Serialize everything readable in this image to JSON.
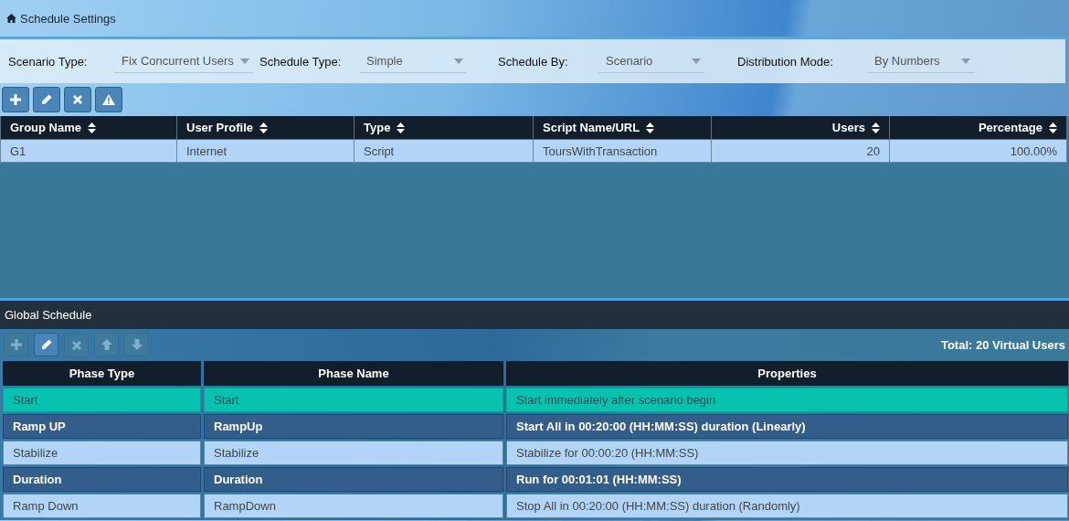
{
  "header": {
    "title": "Schedule Settings"
  },
  "filters": [
    {
      "label": "Scenario Type:",
      "value": "Fix Concurrent Users"
    },
    {
      "label": "Schedule Type:",
      "value": "Simple"
    },
    {
      "label": "Schedule By:",
      "value": "Scenario"
    },
    {
      "label": "Distribution Mode:",
      "value": "By Numbers"
    }
  ],
  "group_toolbar": [
    {
      "kind": "add",
      "disabled": false
    },
    {
      "kind": "edit",
      "disabled": false
    },
    {
      "kind": "delete",
      "disabled": false
    },
    {
      "kind": "warning",
      "disabled": false
    }
  ],
  "groups_table": {
    "columns": [
      {
        "label": "Group Name",
        "kind": "text"
      },
      {
        "label": "User Profile",
        "kind": "text"
      },
      {
        "label": "Type",
        "kind": "text"
      },
      {
        "label": "Script Name/URL",
        "kind": "text"
      },
      {
        "label": "Users",
        "kind": "number"
      },
      {
        "label": "Percentage",
        "kind": "number"
      }
    ],
    "rows": [
      {
        "cells": [
          "G1",
          "Internet",
          "Script",
          "ToursWithTransaction",
          "20",
          "100.00%"
        ]
      }
    ]
  },
  "global_schedule": {
    "title": "Global Schedule",
    "toolbar": [
      {
        "kind": "add",
        "disabled": true
      },
      {
        "kind": "edit",
        "disabled": false
      },
      {
        "kind": "delete",
        "disabled": true
      },
      {
        "kind": "up",
        "disabled": true
      },
      {
        "kind": "down",
        "disabled": true
      }
    ],
    "total": "Total: 20 Virtual Users",
    "columns": [
      "Phase Type",
      "Phase Name",
      "Properties"
    ],
    "rows": [
      {
        "cells": [
          "Start",
          "Start",
          "Start immediately after scenario begin"
        ],
        "selected": true
      },
      {
        "cells": [
          "Ramp UP",
          "RampUp",
          "Start All in 00:20:00 (HH:MM:SS) duration (Linearly)"
        ],
        "selected": false
      },
      {
        "cells": [
          "Stabilize",
          "Stabilize",
          "Stabilize for 00:00:20 (HH:MM:SS)"
        ],
        "selected": false
      },
      {
        "cells": [
          "Duration",
          "Duration",
          "Run for 00:01:01 (HH:MM:SS)"
        ],
        "selected": false
      },
      {
        "cells": [
          "Ramp Down",
          "RampDown",
          "Stop All in 00:20:00 (HH:MM:SS) duration (Randomly)"
        ],
        "selected": false
      }
    ]
  }
}
